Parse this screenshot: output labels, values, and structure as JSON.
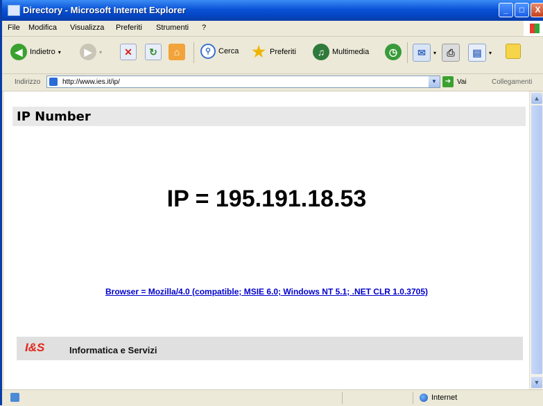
{
  "window": {
    "title": "Directory - Microsoft Internet Explorer",
    "controls": {
      "minimize": "_",
      "maximize": "□",
      "close": "X"
    }
  },
  "menu": {
    "items": [
      "File",
      "Modifica",
      "Visualizza",
      "Preferiti",
      "Strumenti",
      "?"
    ]
  },
  "toolbar": {
    "back_label": "Indietro",
    "search_label": "Cerca",
    "favorites_label": "Preferiti",
    "multimedia_label": "Multimedia"
  },
  "address": {
    "label": "Indirizzo",
    "url": "http://www.ies.it/ip/",
    "go_label": "Vai",
    "links_label": "Collegamenti"
  },
  "page": {
    "heading": "IP Number",
    "ip_text": "IP = 195.191.18.53",
    "browser_text": "Browser = Mozilla/4.0 (compatible; MSIE 6.0; Windows NT 5.1; .NET CLR 1.0.3705)",
    "logo_text": "I&S",
    "footer_text": "Informatica e Servizi"
  },
  "status": {
    "zone_label": "Internet"
  },
  "colors": {
    "title_bar": "#0a53d6",
    "link": "#0000cc",
    "logo": "#e3271b"
  }
}
